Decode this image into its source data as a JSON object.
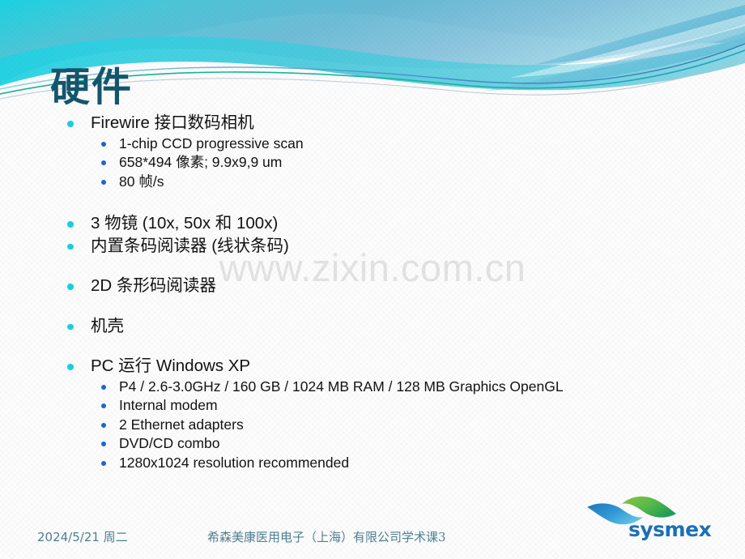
{
  "slide": {
    "title": "硬件",
    "watermark": "www.zixin.com.cn",
    "colors": {
      "title": "#11556b",
      "bullet_level1": "#16d0e0",
      "bullet_level2": "#1b66c9",
      "footer_text": "#4d7f8e",
      "wave_teal": "#3fc6d8",
      "wave_blue": "#6fa8c8",
      "wave_light": "#a9e3ef",
      "logo_blue": "#1a75bb",
      "logo_green": "#57b947",
      "watermark": "#e3e3e3"
    },
    "blocks": [
      {
        "id": "camera",
        "level1": "Firewire 接口数码相机",
        "level2": [
          "1-chip CCD progressive scan",
          "658*494 像素; 9.9x9,9  um",
          "80 帧/s"
        ]
      },
      {
        "id": "optics",
        "items": [
          "3 物镜 (10x, 50x 和 100x)",
          "内置条码阅读器 (线状条码)"
        ]
      },
      {
        "id": "barcode-2d",
        "items": [
          "2D 条形码阅读器"
        ]
      },
      {
        "id": "housing",
        "items": [
          "机壳"
        ]
      },
      {
        "id": "pc",
        "level1": "PC 运行 Windows XP",
        "level2": [
          "P4 / 2.6-3.0GHz / 160 GB / 1024 MB RAM / 128 MB Graphics OpenGL",
          "Internal modem",
          "2 Ethernet adapters",
          "DVD/CD combo",
          "1280x1024 resolution recommended"
        ]
      }
    ]
  },
  "footer": {
    "date": "2024/5/21 周二",
    "company": "希森美康医用电子（上海）有限公司学术课3"
  },
  "logo": {
    "wordmark": "sysmex"
  }
}
